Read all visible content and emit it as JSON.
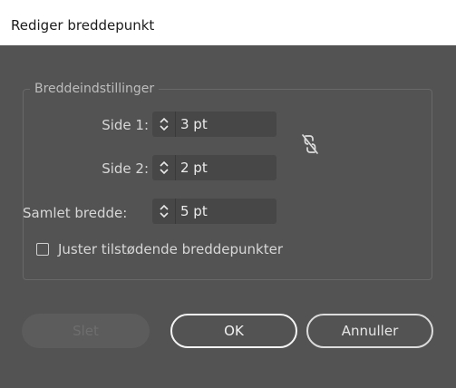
{
  "dialog": {
    "title": "Rediger breddepunkt"
  },
  "width_settings": {
    "legend": "Breddeindstillinger",
    "side1": {
      "label": "Side 1:",
      "value": "3 pt"
    },
    "side2": {
      "label": "Side 2:",
      "value": "2 pt"
    },
    "total": {
      "label": "Samlet bredde:",
      "value": "5 pt"
    },
    "link_icon": "unlink-chain-icon",
    "adjust_checkbox": {
      "label": "Juster tilstødende breddepunkter",
      "checked": false
    }
  },
  "buttons": {
    "delete": "Slet",
    "ok": "OK",
    "cancel": "Annuller"
  },
  "colors": {
    "background": "#535353",
    "field": "#474747",
    "titlebar": "#ffffff"
  }
}
